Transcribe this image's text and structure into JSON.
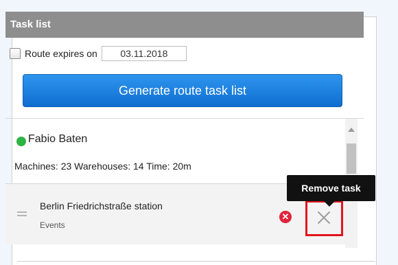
{
  "panel": {
    "title": "Task list"
  },
  "route": {
    "expires_label": "Route expires on",
    "expires_date": "03.11.2018",
    "expires_checked": false,
    "generate_button_label": "Generate route task list"
  },
  "driver": {
    "name": "Fabio Baten",
    "status_color": "#2fb344",
    "stats": "Machines: 23 Warehouses: 14 Time: 20m"
  },
  "task": {
    "title": "Berlin Friedrichstraße station",
    "subtitle": "Events",
    "status_icon": "error-icon",
    "remove_tooltip": "Remove task"
  },
  "colors": {
    "header_bg": "#8e8e8e",
    "button_blue": "#1a7fde",
    "error_red": "#e0243a",
    "highlight_red": "#e2141b"
  }
}
